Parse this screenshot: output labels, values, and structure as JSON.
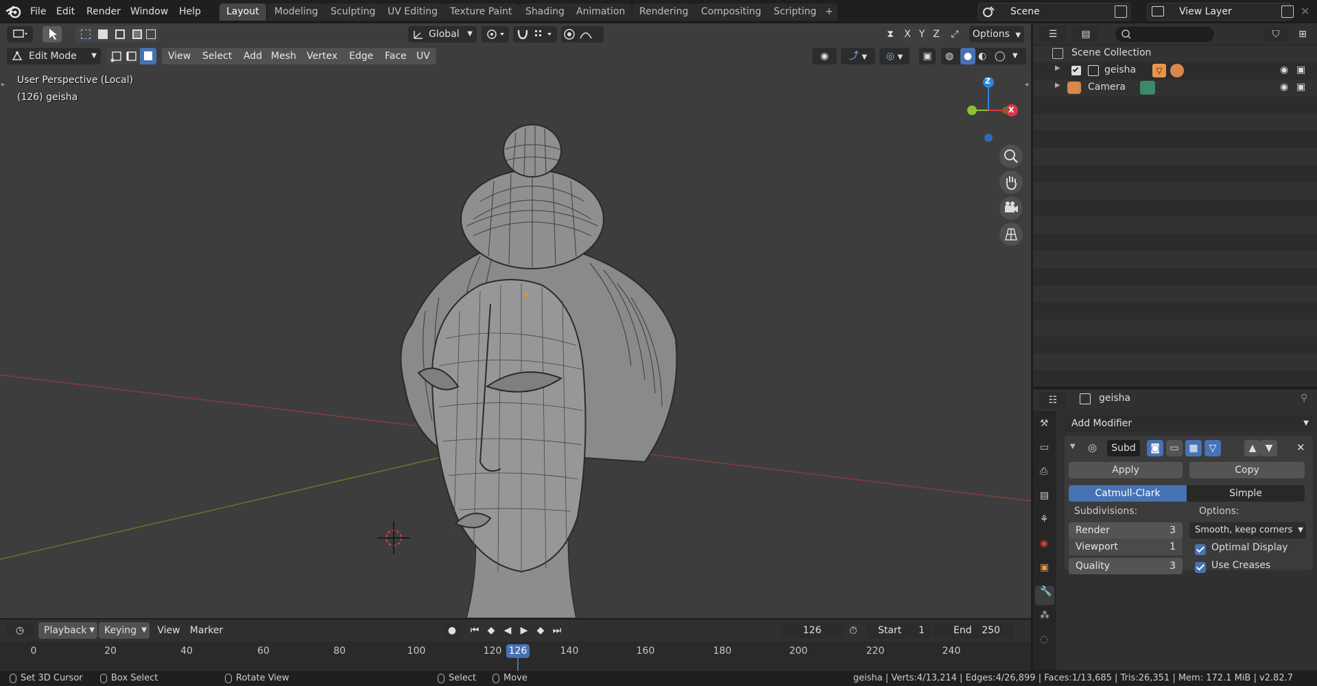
{
  "topbar": {
    "menus": [
      "File",
      "Edit",
      "Render",
      "Window",
      "Help"
    ],
    "tabs": [
      "Layout",
      "Modeling",
      "Sculpting",
      "UV Editing",
      "Texture Paint",
      "Shading",
      "Animation",
      "Rendering",
      "Compositing",
      "Scripting"
    ],
    "active_tab": "Layout",
    "add_tab": "+",
    "scene": "Scene",
    "view_layer": "View Layer"
  },
  "viewport": {
    "transform_orientation": "Global",
    "options": "Options",
    "axis_x": "X",
    "axis_y": "Y",
    "axis_z": "Z",
    "mode": "Edit Mode",
    "menus": [
      "View",
      "Select",
      "Add",
      "Mesh",
      "Vertex",
      "Edge",
      "Face",
      "UV"
    ],
    "perspective_label": "User Perspective (Local)",
    "object_label": "(126) geisha",
    "gizmo_x": "X",
    "gizmo_z": "Z"
  },
  "outliner": {
    "search_placeholder": "",
    "root": "Scene Collection",
    "items": [
      {
        "name": "geisha"
      },
      {
        "name": "Camera"
      }
    ]
  },
  "properties": {
    "object_name": "geisha",
    "add_modifier": "Add Modifier",
    "modifier_name": "Subd",
    "apply": "Apply",
    "copy": "Copy",
    "algorithm_catmull": "Catmull-Clark",
    "algorithm_simple": "Simple",
    "subdivisions_label": "Subdivisions:",
    "options_label": "Options:",
    "render_label": "Render",
    "render_value": "3",
    "viewport_label": "Viewport",
    "viewport_value": "1",
    "quality_label": "Quality",
    "quality_value": "3",
    "uv_smooth": "Smooth, keep corners",
    "optimal_display": "Optimal Display",
    "use_creases": "Use Creases"
  },
  "timeline": {
    "playback": "Playback",
    "keying": "Keying",
    "view": "View",
    "marker": "Marker",
    "current_frame": "126",
    "start_label": "Start",
    "start_value": "1",
    "end_label": "End",
    "end_value": "250",
    "ticks": [
      "0",
      "20",
      "40",
      "60",
      "80",
      "100",
      "120",
      "140",
      "160",
      "180",
      "200",
      "220",
      "240"
    ],
    "playhead": "126"
  },
  "statusbar": {
    "set_cursor": "Set 3D Cursor",
    "box_select": "Box Select",
    "rotate_view": "Rotate View",
    "select": "Select",
    "move": "Move",
    "stats": "geisha | Verts:4/13,214 | Edges:4/26,899 | Faces:1/13,685 | Tris:26,351 | Mem: 172.1 MiB | v2.82.7"
  },
  "colors": {
    "accent": "#4772b3",
    "x_axis": "#e0344a",
    "y_axis": "#8bc034",
    "z_axis": "#2c84d8"
  }
}
